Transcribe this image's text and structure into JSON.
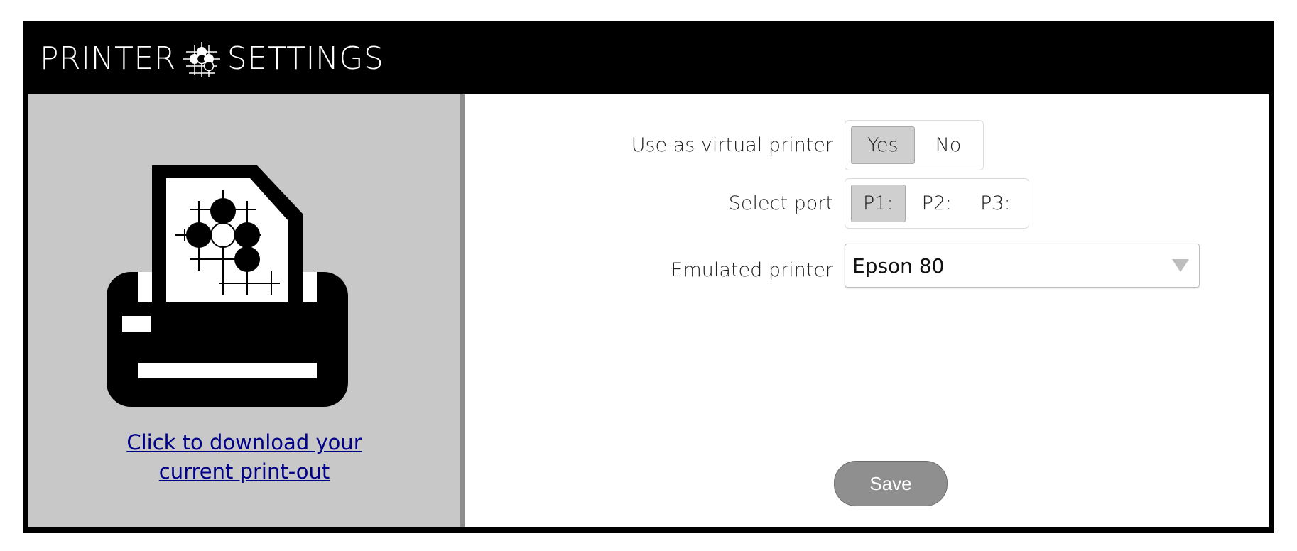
{
  "header": {
    "title_left": "PRINTER",
    "title_right": "SETTINGS",
    "logo_icon": "go-stones-logo-icon"
  },
  "left_panel": {
    "illustration_icon": "printer-with-go-board-icon",
    "download_link_line1": "Click to download your",
    "download_link_line2": "current print-out"
  },
  "settings": {
    "virtual_printer": {
      "label": "Use as virtual printer",
      "options": [
        "Yes",
        "No"
      ],
      "selected": "Yes"
    },
    "port": {
      "label": "Select port",
      "options": [
        "P1:",
        "P2:",
        "P3:"
      ],
      "selected": "P1:"
    },
    "emulated_printer": {
      "label": "Emulated printer",
      "value": "Epson 80"
    },
    "save_label": "Save"
  },
  "colors": {
    "header_bg": "#000000",
    "left_panel_bg": "#c8c8c8",
    "active_segment": "#cfcfcf",
    "save_button": "#8f8f8f",
    "link": "#000088"
  }
}
